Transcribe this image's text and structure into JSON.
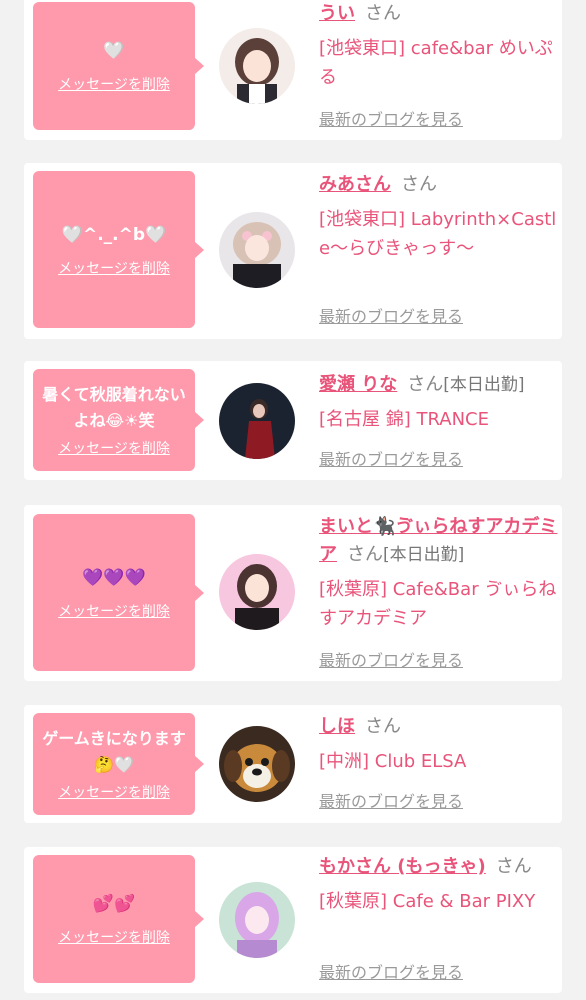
{
  "common": {
    "delete_label": "メッセージを削除",
    "san_label": "さん",
    "blog_label": "最新のブログを見る",
    "accent_color": "#e9547a",
    "bubble_color": "#ff9aad"
  },
  "items": [
    {
      "message": "🤍",
      "name": "うい",
      "badge": "",
      "shop": "[池袋東口] cafe&bar めいぷる"
    },
    {
      "message": "🤍^._.^b🤍",
      "name": "みあさん",
      "badge": "",
      "shop": "[池袋東口] Labyrinth×Castle〜らびきゃっす〜"
    },
    {
      "message": "暑くて秋服着れないよね😂☀笑",
      "name": "愛瀬 りな",
      "badge": "[本日出勤]",
      "shop": "[名古屋 錦] TRANCE"
    },
    {
      "message": "💜💜💜",
      "name": "まいと🐈‍⬛ゔぃらねすアカデミア",
      "badge": "[本日出勤]",
      "shop": "[秋葉原] Cafe&Bar ゔぃらねすアカデミア"
    },
    {
      "message": "ゲームきになります🤔🤍",
      "name": "しほ",
      "badge": "",
      "shop": "[中洲] Club ELSA"
    },
    {
      "message": "💕💕",
      "name": "もかさん (もっきゃ)",
      "badge": "",
      "shop": "[秋葉原] Cafe & Bar PIXY"
    }
  ]
}
